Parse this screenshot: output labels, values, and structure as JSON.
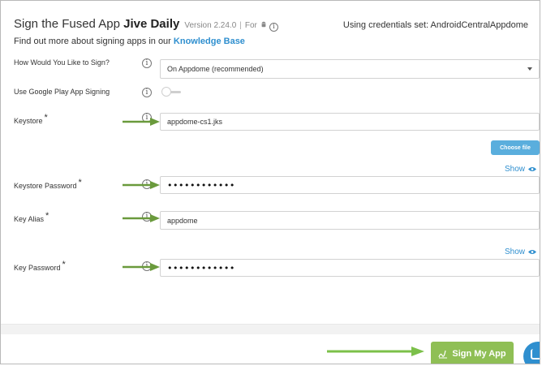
{
  "header": {
    "title_prefix": "Sign the Fused App ",
    "app_name": "Jive Daily",
    "version": "Version 2.24.0",
    "separator": "|",
    "for_label": "For",
    "credentials": "Using credentials set: AndroidCentralAppdome",
    "find_more_text": "Find out more about signing apps in our ",
    "knowledge_base_link": "Knowledge Base"
  },
  "form": {
    "sign_method": {
      "label": "How Would You Like to Sign?",
      "value": "On Appdome (recommended)"
    },
    "google_play_signing": {
      "label": "Use Google Play App Signing",
      "enabled": false
    },
    "keystore": {
      "label": "Keystore",
      "required": "*",
      "value": "appdome-cs1.jks",
      "choose_file_label": "Choose file"
    },
    "keystore_password": {
      "label": "Keystore Password",
      "required": "*",
      "masked_value": "••••••••••••",
      "show_label": "Show"
    },
    "key_alias": {
      "label": "Key Alias",
      "required": "*",
      "value": "appdome"
    },
    "key_password": {
      "label": "Key Password",
      "required": "*",
      "masked_value": "••••••••••••",
      "show_label": "Show"
    }
  },
  "actions": {
    "sign_button_label": "Sign My App"
  },
  "icons": {
    "info": "i",
    "android": "android-icon",
    "eye": "eye-icon",
    "chat": "chat-icon"
  },
  "colors": {
    "link": "#2f8fcf",
    "primary_button": "#8fbf55",
    "choose_file_button": "#5aaedd",
    "annotation_arrow": "#6a9a3c"
  }
}
